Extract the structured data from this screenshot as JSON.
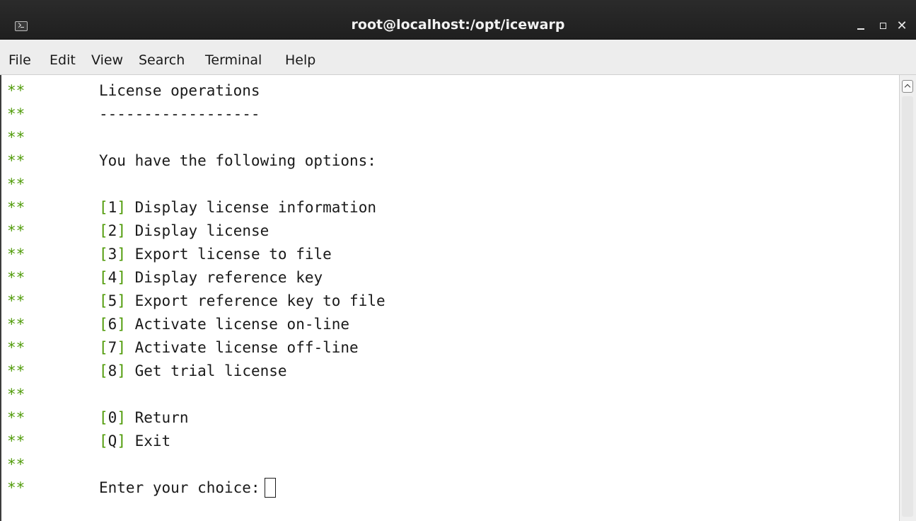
{
  "window": {
    "title": "root@localhost:/opt/icewarp"
  },
  "menu": {
    "items": [
      "File",
      "Edit",
      "View",
      "Search",
      "Terminal",
      "Help"
    ]
  },
  "terminal": {
    "prefix": "**",
    "lines": [
      {
        "prefix": "**",
        "text": "License operations"
      },
      {
        "prefix": "**",
        "text": "------------------"
      },
      {
        "prefix": "**",
        "text": ""
      },
      {
        "prefix": "**",
        "text": "You have the following options:"
      },
      {
        "prefix": "**",
        "text": ""
      },
      {
        "prefix": "**",
        "key": "1",
        "label": "Display license information"
      },
      {
        "prefix": "**",
        "key": "2",
        "label": "Display license"
      },
      {
        "prefix": "**",
        "key": "3",
        "label": "Export license to file"
      },
      {
        "prefix": "**",
        "key": "4",
        "label": "Display reference key"
      },
      {
        "prefix": "**",
        "key": "5",
        "label": "Export reference key to file"
      },
      {
        "prefix": "**",
        "key": "6",
        "label": "Activate license on-line"
      },
      {
        "prefix": "**",
        "key": "7",
        "label": "Activate license off-line"
      },
      {
        "prefix": "**",
        "key": "8",
        "label": "Get trial license"
      },
      {
        "prefix": "**",
        "text": ""
      },
      {
        "prefix": "**",
        "key": "0",
        "label": "Return"
      },
      {
        "prefix": "**",
        "key": "Q",
        "label": "Exit"
      },
      {
        "prefix": "**",
        "text": ""
      },
      {
        "prefix": "**",
        "text": "Enter your choice:",
        "cursor": true
      }
    ]
  },
  "icons": {
    "app": "terminal-icon",
    "minimize": "minimize-icon",
    "maximize": "maximize-icon",
    "close": "close-icon",
    "scroll_up": "scroll-up-icon"
  },
  "colors": {
    "prefix": "#4e9a06",
    "bracket": "#4e9a06",
    "text": "#1a1a1a",
    "titlebar": "#2b2b2b"
  }
}
